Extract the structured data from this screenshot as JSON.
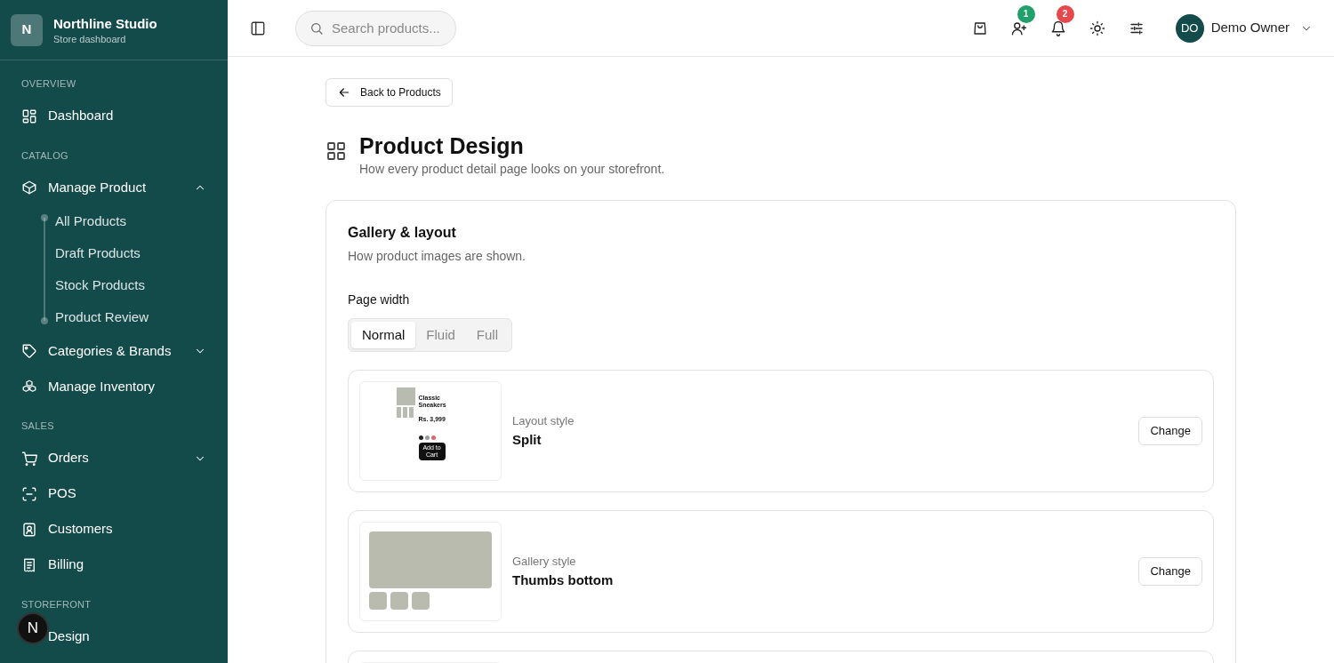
{
  "sidebar": {
    "brand": {
      "initial": "N",
      "name": "Northline Studio",
      "subtitle": "Store dashboard"
    },
    "sections": [
      {
        "title": "OVERVIEW",
        "items": [
          {
            "kind": "link",
            "label": "Dashboard"
          }
        ]
      },
      {
        "title": "CATALOG",
        "items": [
          {
            "kind": "group",
            "label": "Manage Product",
            "expanded": true,
            "children": [
              {
                "label": "All Products"
              },
              {
                "label": "Draft Products"
              },
              {
                "label": "Stock Products"
              },
              {
                "label": "Product Review"
              }
            ]
          },
          {
            "kind": "group",
            "label": "Categories & Brands",
            "expanded": false
          },
          {
            "kind": "link",
            "label": "Manage Inventory"
          }
        ]
      },
      {
        "title": "SALES",
        "items": [
          {
            "kind": "group",
            "label": "Orders",
            "expanded": false
          },
          {
            "kind": "link",
            "label": "POS"
          },
          {
            "kind": "link",
            "label": "Customers"
          },
          {
            "kind": "link",
            "label": "Billing"
          }
        ]
      },
      {
        "title": "STOREFRONT",
        "items": [
          {
            "kind": "link",
            "label": "Design"
          }
        ]
      }
    ]
  },
  "dev_badge": "N",
  "header": {
    "search": {
      "placeholder": "Search products..."
    },
    "actions": [
      {
        "kind": "bag"
      },
      {
        "kind": "user_plus",
        "badge": "1",
        "color": "#22a06b"
      },
      {
        "kind": "bell",
        "badge": "2",
        "color": "#e5484d"
      },
      {
        "kind": "sun"
      },
      {
        "kind": "sliders"
      }
    ],
    "user": {
      "initials": "DO",
      "name": "Demo Owner"
    }
  },
  "back_button": "Back to Products",
  "page": {
    "title": "Product Design",
    "subtitle": "How every product detail page looks on your storefront."
  },
  "card": {
    "title": "Gallery & layout",
    "subtitle": "How product images are shown.",
    "page_width": {
      "label": "Page width",
      "options": [
        {
          "label": "Normal",
          "selected": true
        },
        {
          "label": "Fluid",
          "selected": false
        },
        {
          "label": "Full",
          "selected": false
        }
      ]
    },
    "rows": [
      {
        "kind": "split",
        "label": "Layout style",
        "value": "Split",
        "button": "Change",
        "preview": {
          "title": "Classic Sneakers",
          "price": "Rs. 3,999",
          "cta": "Add to Cart"
        }
      },
      {
        "kind": "thumbs_bottom",
        "label": "Gallery style",
        "value": "Thumbs bottom",
        "button": "Change"
      },
      {
        "kind": "blank"
      }
    ]
  }
}
